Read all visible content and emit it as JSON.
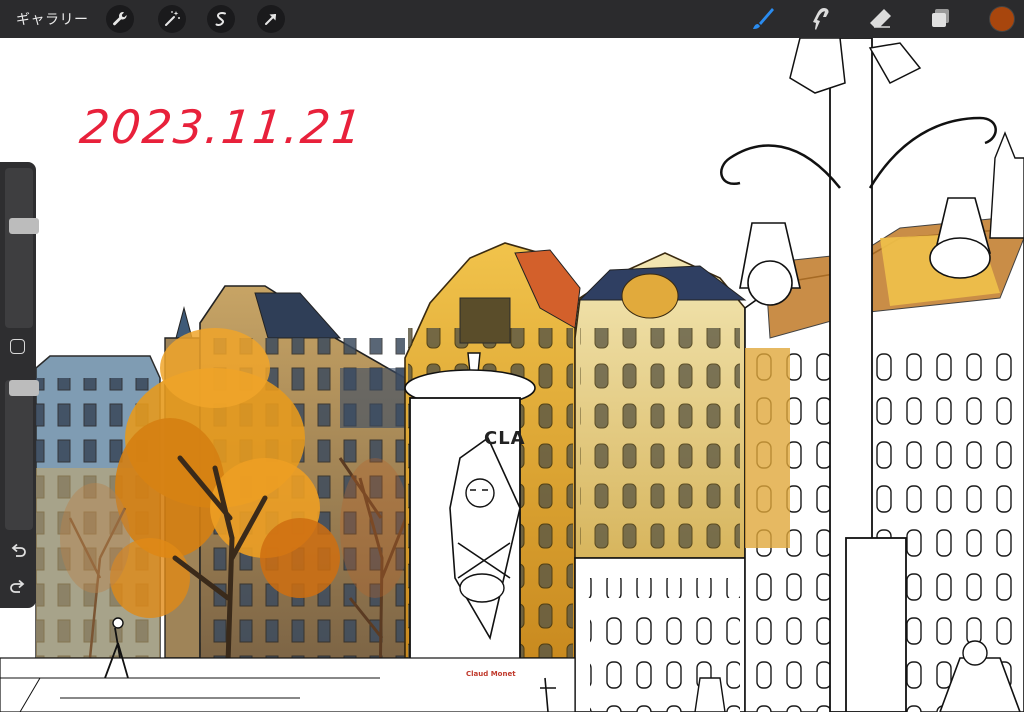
{
  "app": {
    "gallery_label": "ギャラリー"
  },
  "toolbar": {
    "left_buttons": [
      "wrench-icon",
      "magic-wand-icon",
      "selection-icon",
      "transform-arrow-icon"
    ],
    "right_tools": [
      "brush-icon",
      "smudge-icon",
      "eraser-icon",
      "layers-icon"
    ],
    "active_tool": "brush-icon",
    "active_tool_color": "#2a8cf0",
    "current_color": "#a8460d"
  },
  "canvas": {
    "date_text": "2023.11.21",
    "column_text": "CLA",
    "signature_text": "Claud Monet"
  },
  "sidebar": {
    "brush_size_level": 0.65,
    "opacity_level": 1.0,
    "undo_icon": "undo-icon",
    "redo_icon": "redo-icon"
  }
}
